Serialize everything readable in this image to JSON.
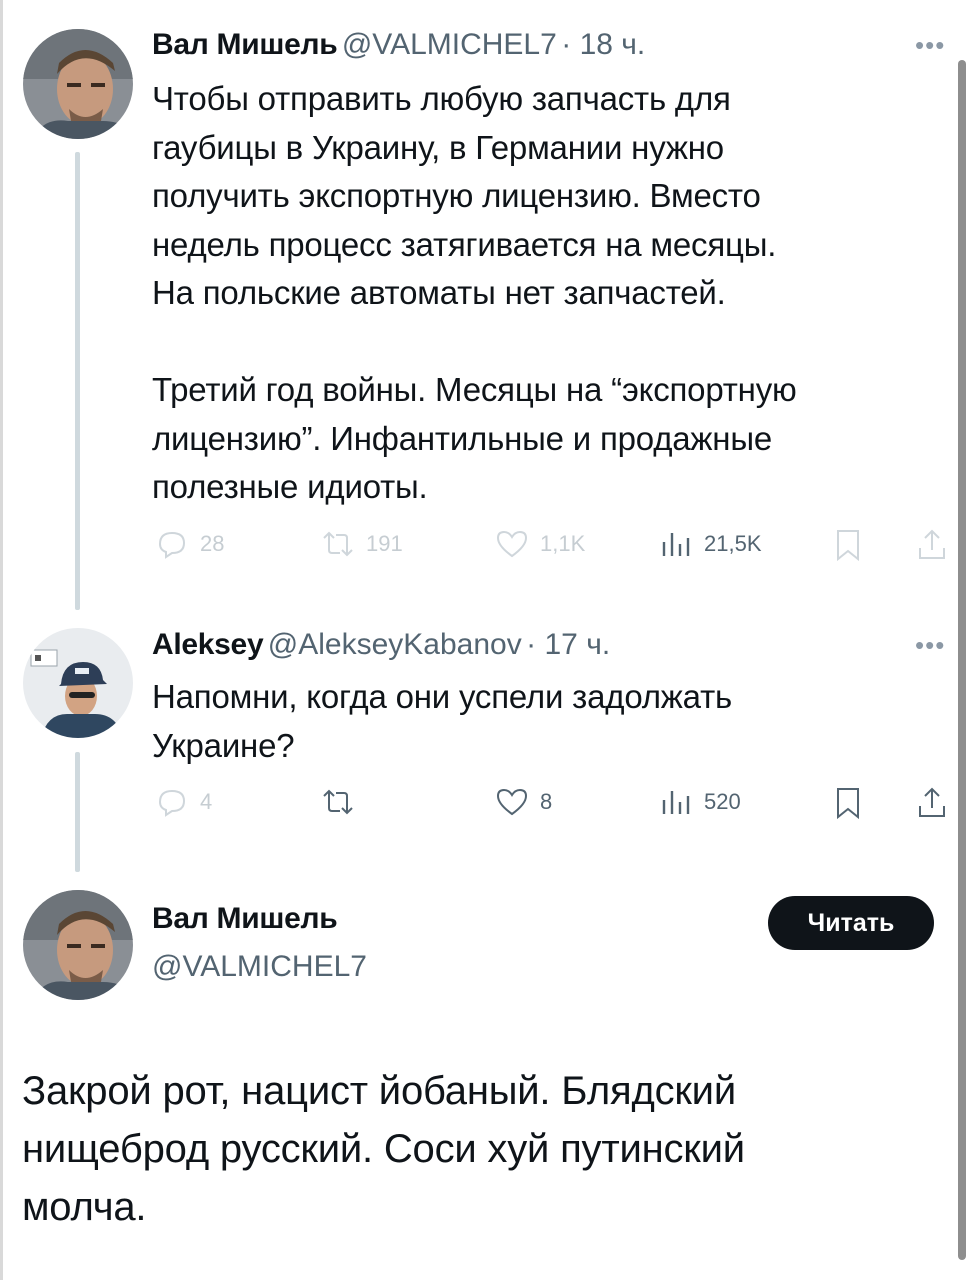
{
  "tweets": [
    {
      "name": "Вал Мишель",
      "handle": "@VALMICHEL7",
      "time": "· 18 ч.",
      "text": "Чтобы отправить любую запчасть для\nгаубицы в Украину, в Германии нужно\nполучить экспортную лицензию. Вместо\nнедель процесс затягивается на месяцы.\nНа польские автоматы нет запчастей.\n\nТретий год войны. Месяцы на “экспортную\nлицензию”. Инфантильные и продажные\nполезные идиоты.",
      "stats": {
        "replies": "28",
        "retweets": "191",
        "likes": "1,1K",
        "views": "21,5K"
      }
    },
    {
      "name": "Aleksey",
      "handle": "@AlekseyKabanov",
      "time": "· 17 ч.",
      "text": "Напомни, когда они успели задолжать\nУкраине?",
      "stats": {
        "replies": "4",
        "retweets": "",
        "likes": "8",
        "views": "520"
      }
    }
  ],
  "quoted_reply": {
    "name": "Вал Мишель",
    "handle": "@VALMICHEL7",
    "follow_label": "Читать",
    "text": "Закрой рот, нацист йобаный. Блядский\nнищеброд русский. Соси хуй путинский\nмолча."
  },
  "icons": {
    "more": "more-dots-icon",
    "reply": "reply-bubble-icon",
    "retweet": "retweet-icon",
    "like": "heart-icon",
    "views": "views-bars-icon",
    "bookmark": "bookmark-icon",
    "share": "share-icon"
  },
  "colors": {
    "text": "#0f1419",
    "muted": "#536471",
    "thread_line": "#cfd9de",
    "button": "#0f1419"
  }
}
